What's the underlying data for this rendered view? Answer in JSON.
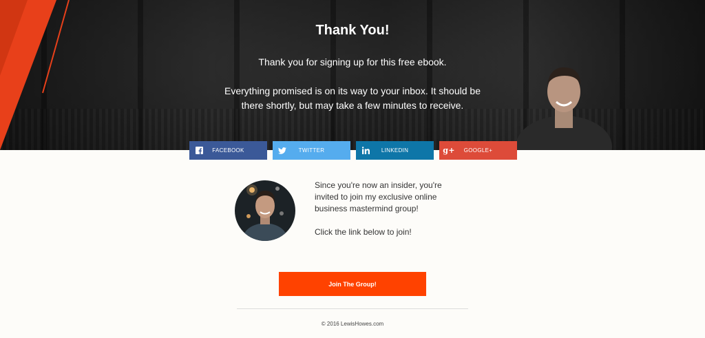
{
  "hero": {
    "title": "Thank You!",
    "line1": "Thank you for signing up for this free ebook.",
    "line2": "Everything promised is on its way to your inbox. It should be there shortly, but may take a few minutes to receive."
  },
  "social": [
    {
      "label": "FACEBOOK",
      "icon": "facebook-icon",
      "color": "#3b5998"
    },
    {
      "label": "TWITTER",
      "icon": "twitter-icon",
      "color": "#55acee"
    },
    {
      "label": "LINKEDIN",
      "icon": "linkedin-icon",
      "color": "#0e76a8"
    },
    {
      "label": "GOOGLE+",
      "icon": "google-plus-icon",
      "color": "#dd4b39"
    }
  ],
  "invite": {
    "text": "Since you're now an insider, you're invited to join my exclusive online business mastermind group!",
    "cta_text": "Click the link below to join!"
  },
  "join_button": {
    "label": "Join The Group!",
    "color": "#ff4200"
  },
  "footer": {
    "copyright": "© 2016 LewisHowes.com"
  },
  "colors": {
    "accent": "#ff4200",
    "orange_shape": "#e8401a"
  }
}
